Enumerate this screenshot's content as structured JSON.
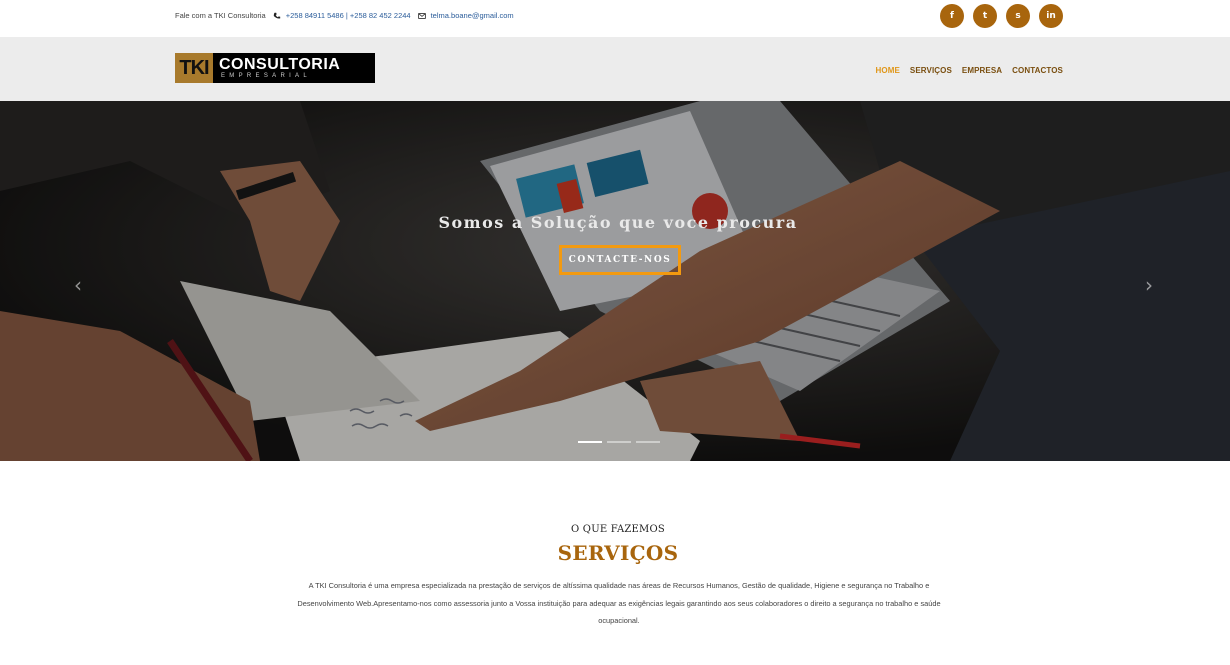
{
  "topbar": {
    "contact_label": "Fale com a TKI Consultoria",
    "phone_numbers": "+258 84911 5486 | +258 82 452 2244",
    "email": "telma.boane@gmail.com",
    "social": [
      {
        "icon": "facebook-icon",
        "glyph": "f"
      },
      {
        "icon": "twitter-icon",
        "glyph": "t"
      },
      {
        "icon": "skype-icon",
        "glyph": "s"
      },
      {
        "icon": "linkedin-icon",
        "glyph": "in"
      }
    ]
  },
  "logo": {
    "mark": "TKI",
    "name": "CONSULTORIA",
    "tagline": "EMPRESARIAL"
  },
  "nav": {
    "items": [
      {
        "label": "HOME",
        "active": true
      },
      {
        "label": "SERVIÇOS",
        "active": false
      },
      {
        "label": "EMPRESA",
        "active": false
      },
      {
        "label": "CONTACTOS",
        "active": false
      }
    ]
  },
  "hero": {
    "headline": "Somos a Solução que voce procura",
    "cta_label": "CONTACTE-NOS",
    "prev_arrow": "‹",
    "next_arrow": "›",
    "active_slide": 1,
    "slide_count": 3
  },
  "services": {
    "eyebrow": "O QUE FAZEMOS",
    "title": "SERVIÇOS",
    "description": "A TKI Consultoria é uma empresa especializada na prestação de serviços de altíssima qualidade nas áreas de Recursos Humanos, Gestão de qualidade, Higiene e segurança no Trabalho e Desenvolvimento Web.Apresentamo-nos como assessoria junto a Vossa instituição para adequar as exigências legais garantindo aos seus colaboradores o direito a segurança no trabalho e saúde ocupacional."
  },
  "colors": {
    "accent": "#a8650d",
    "nav_active": "#e0971a",
    "cta_border": "#f39a10",
    "header_bg": "#ececec"
  }
}
